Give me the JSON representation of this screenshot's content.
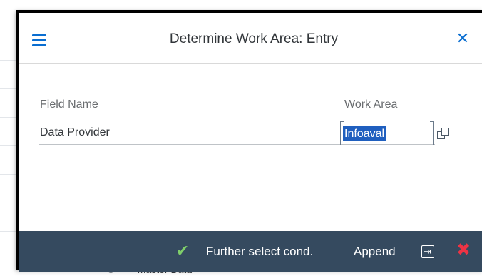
{
  "dialog": {
    "title": "Determine Work Area: Entry",
    "menu_icon": "hamburger-menu-icon",
    "close_icon": "close-icon",
    "close_glyph": "✕"
  },
  "table": {
    "headers": {
      "field_name": "Field Name",
      "work_area": "Work Area"
    },
    "rows": [
      {
        "field_name": "Data Provider",
        "work_area": "Infoaval"
      }
    ],
    "value_help_icon": "value-help-icon"
  },
  "footer": {
    "check_icon": "checkmark-icon",
    "check_glyph": "✔",
    "further_select_label": "Further select cond.",
    "append_label": "Append",
    "transfer_icon": "transfer-icon",
    "transfer_glyph": "⇥",
    "cancel_icon": "cancel-icon",
    "cancel_glyph": "✖"
  },
  "background": {
    "row_icon": "tree-node-icon",
    "row_icon_glyph": "⊘",
    "row_label": "Master Data"
  },
  "colors": {
    "accent": "#0a6ed1",
    "footer_bg": "#354a5f",
    "selection": "#1f5fbf",
    "success": "#7fce6a",
    "danger": "#ee3344"
  }
}
